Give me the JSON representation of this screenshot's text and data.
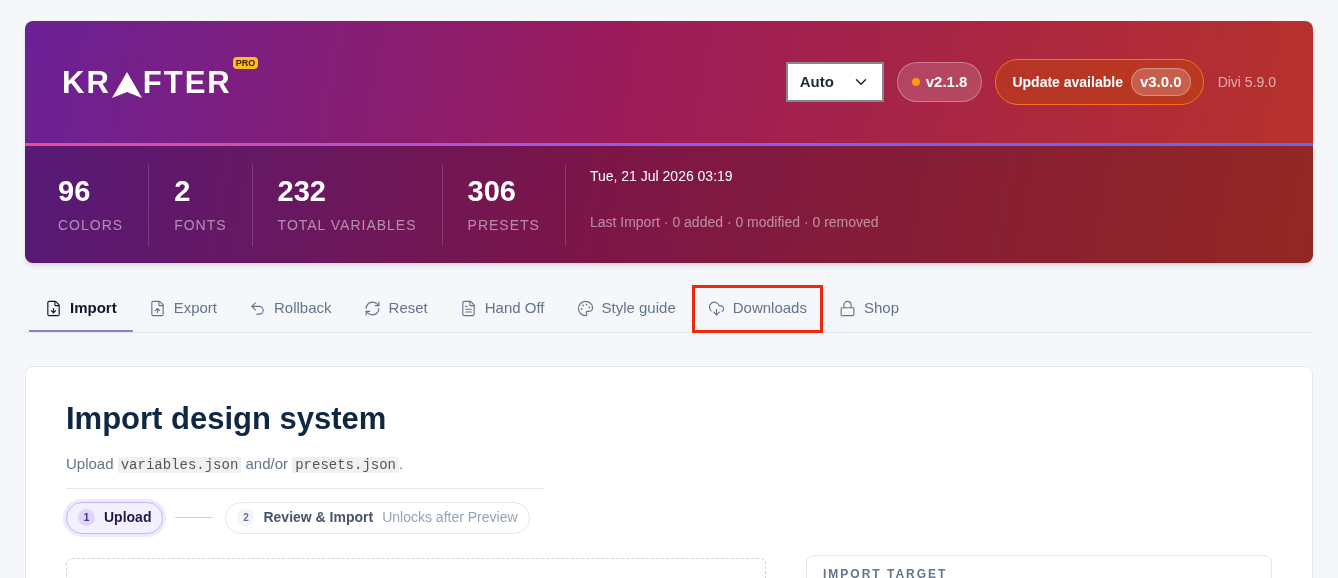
{
  "header": {
    "logo": {
      "left": "KR",
      "right": "FTER",
      "badge": "PRO"
    },
    "mode_select": {
      "value": "Auto"
    },
    "version": {
      "text": "v2.1.8",
      "color": "#f59e0b"
    },
    "update": {
      "label": "Update available",
      "version": "v3.0.0"
    },
    "platform": "Divi 5.9.0",
    "stats": [
      {
        "value": "96",
        "label": "COLORS"
      },
      {
        "value": "2",
        "label": "FONTS"
      },
      {
        "value": "232",
        "label": "TOTAL VARIABLES"
      },
      {
        "value": "306",
        "label": "PRESETS"
      }
    ],
    "last_import": {
      "date": "Tue, 21 Jul 2026 03:19",
      "summary": "Last Import · 0 added · 0 modified · 0 removed"
    }
  },
  "tabs": [
    {
      "label": "Import",
      "kind": "import",
      "selected": true,
      "highlighted": false
    },
    {
      "label": "Export",
      "kind": "export",
      "selected": false,
      "highlighted": false
    },
    {
      "label": "Rollback",
      "kind": "rollback",
      "selected": false,
      "highlighted": false
    },
    {
      "label": "Reset",
      "kind": "reset",
      "selected": false,
      "highlighted": false
    },
    {
      "label": "Hand Off",
      "kind": "handoff",
      "selected": false,
      "highlighted": false
    },
    {
      "label": "Style guide",
      "kind": "palette",
      "selected": false,
      "highlighted": false
    },
    {
      "label": "Downloads",
      "kind": "download",
      "selected": false,
      "highlighted": true
    },
    {
      "label": "Shop",
      "kind": "lock",
      "selected": false,
      "highlighted": false
    }
  ],
  "content": {
    "title": "Import design system",
    "subtitle": [
      {
        "kind": "text",
        "text": "Upload "
      },
      {
        "kind": "code",
        "text": "variables.json"
      },
      {
        "kind": "text",
        "text": " and/or "
      },
      {
        "kind": "code",
        "text": "presets.json"
      },
      {
        "kind": "text",
        "text": "."
      }
    ],
    "steps": [
      {
        "number": "1",
        "label": "Upload",
        "selected": true
      },
      {
        "number": "2",
        "label": "Review & Import",
        "note": "Unlocks after Preview",
        "selected": false
      }
    ],
    "side_panel": {
      "title": "IMPORT TARGET"
    }
  }
}
